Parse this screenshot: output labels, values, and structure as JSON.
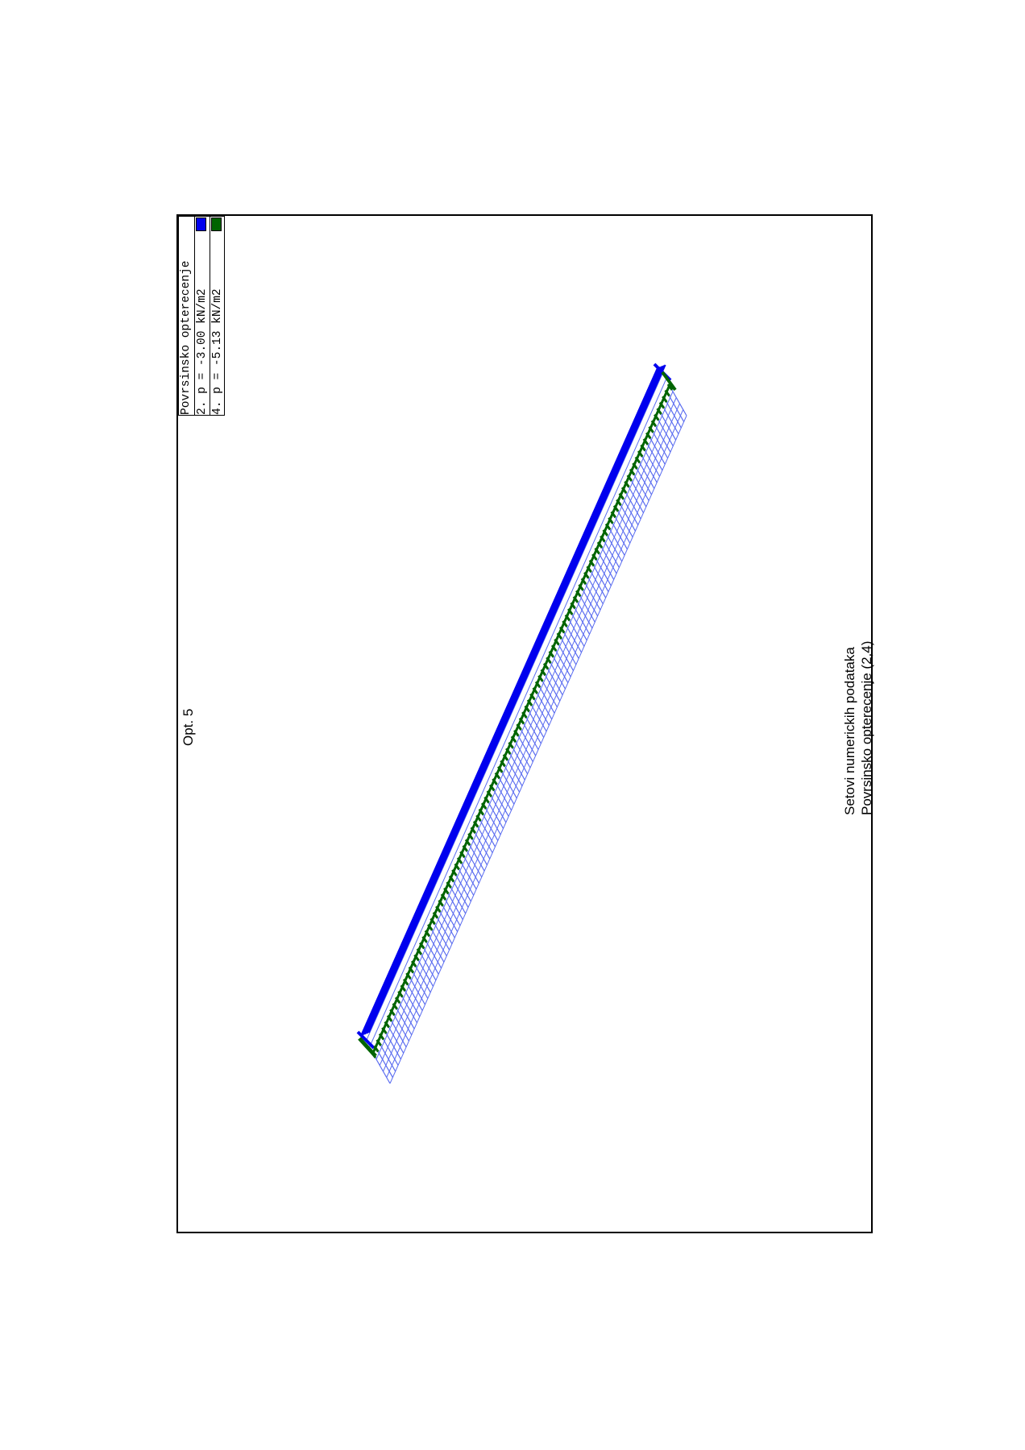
{
  "title": "Opt. 5",
  "legend": {
    "heading": "Povrsinsko opterecenje",
    "entries": [
      {
        "label": "2. p = -3.00 kN/m2",
        "color": "#0000ee"
      },
      {
        "label": "4. p = -5.13 kN/m2",
        "color": "#006400"
      }
    ]
  },
  "footer": {
    "line1": "Setovi numerickih podataka",
    "line2": "Povrsinsko opterecenje (2,4)"
  },
  "colors": {
    "load_set_2": "#0000ee",
    "load_set_4": "#006400",
    "mesh": "#5a6cf0"
  }
}
